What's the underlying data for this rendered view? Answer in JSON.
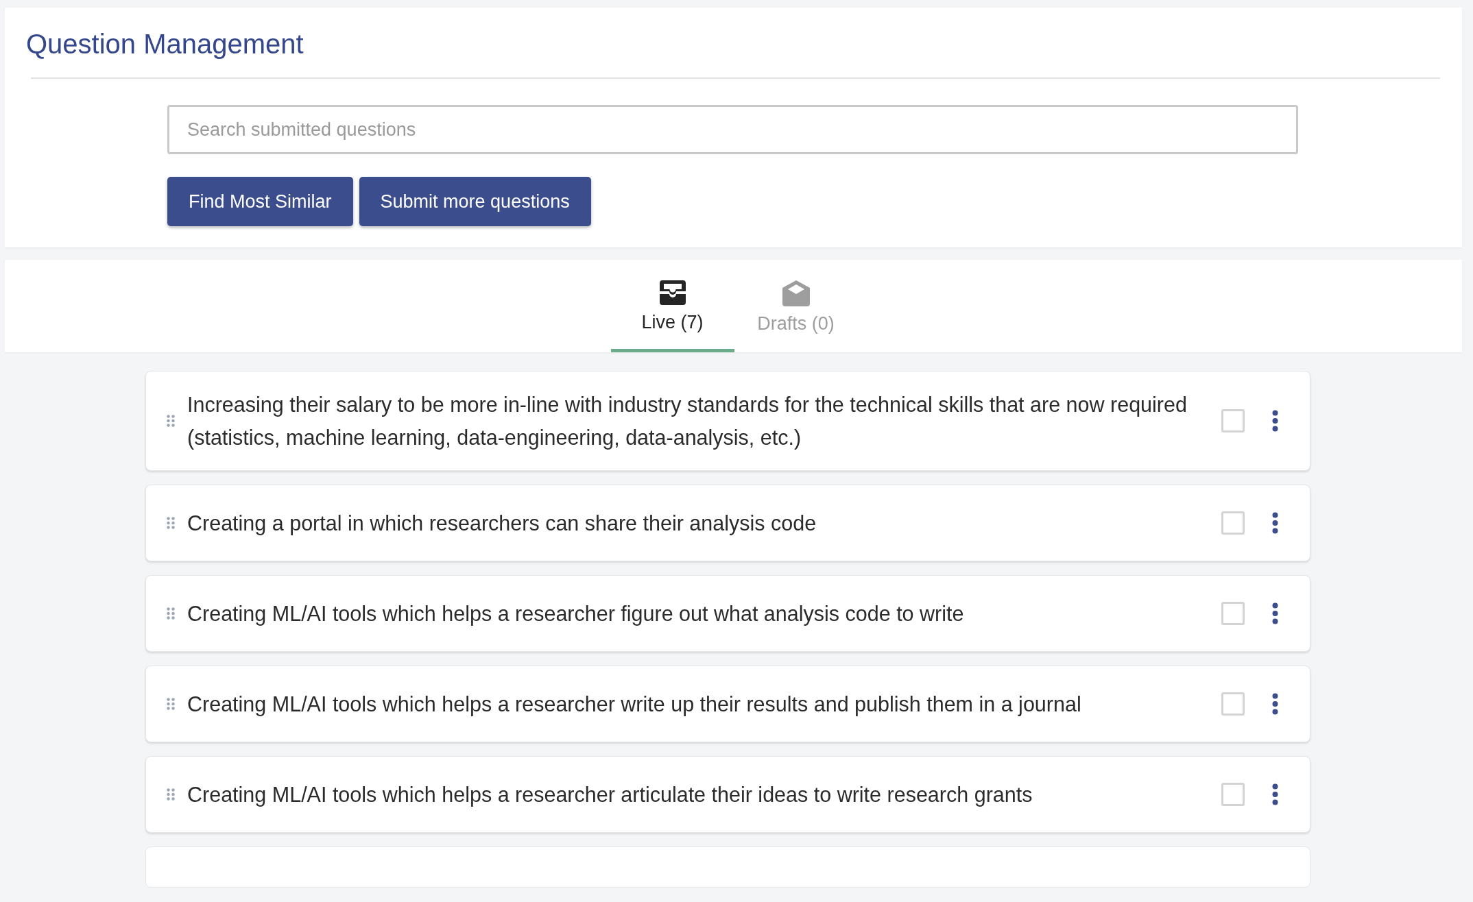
{
  "header": {
    "title": "Question Management",
    "search": {
      "placeholder": "Search submitted questions"
    },
    "buttons": [
      "Find Most Similar",
      "Submit more questions"
    ]
  },
  "tabs": [
    {
      "label": "Live (7)",
      "kind": "inbox",
      "selected": true
    },
    {
      "label": "Drafts (0)",
      "kind": "envelope",
      "selected": false
    }
  ],
  "questions": [
    {
      "text": "Increasing their salary to be more in-line with industry standards for the technical skills that are now required (statistics, machine learning, data-engineering, data-analysis, etc.)",
      "checked": false
    },
    {
      "text": "Creating a portal in which researchers can share their analysis code",
      "checked": false
    },
    {
      "text": "Creating ML/AI tools which helps a researcher figure out what analysis code to write",
      "checked": false
    },
    {
      "text": "Creating ML/AI tools which helps a researcher write up their results and publish them in a journal",
      "checked": false
    },
    {
      "text": "Creating ML/AI tools which helps a researcher articulate their ideas to write research grants",
      "checked": false
    }
  ]
}
